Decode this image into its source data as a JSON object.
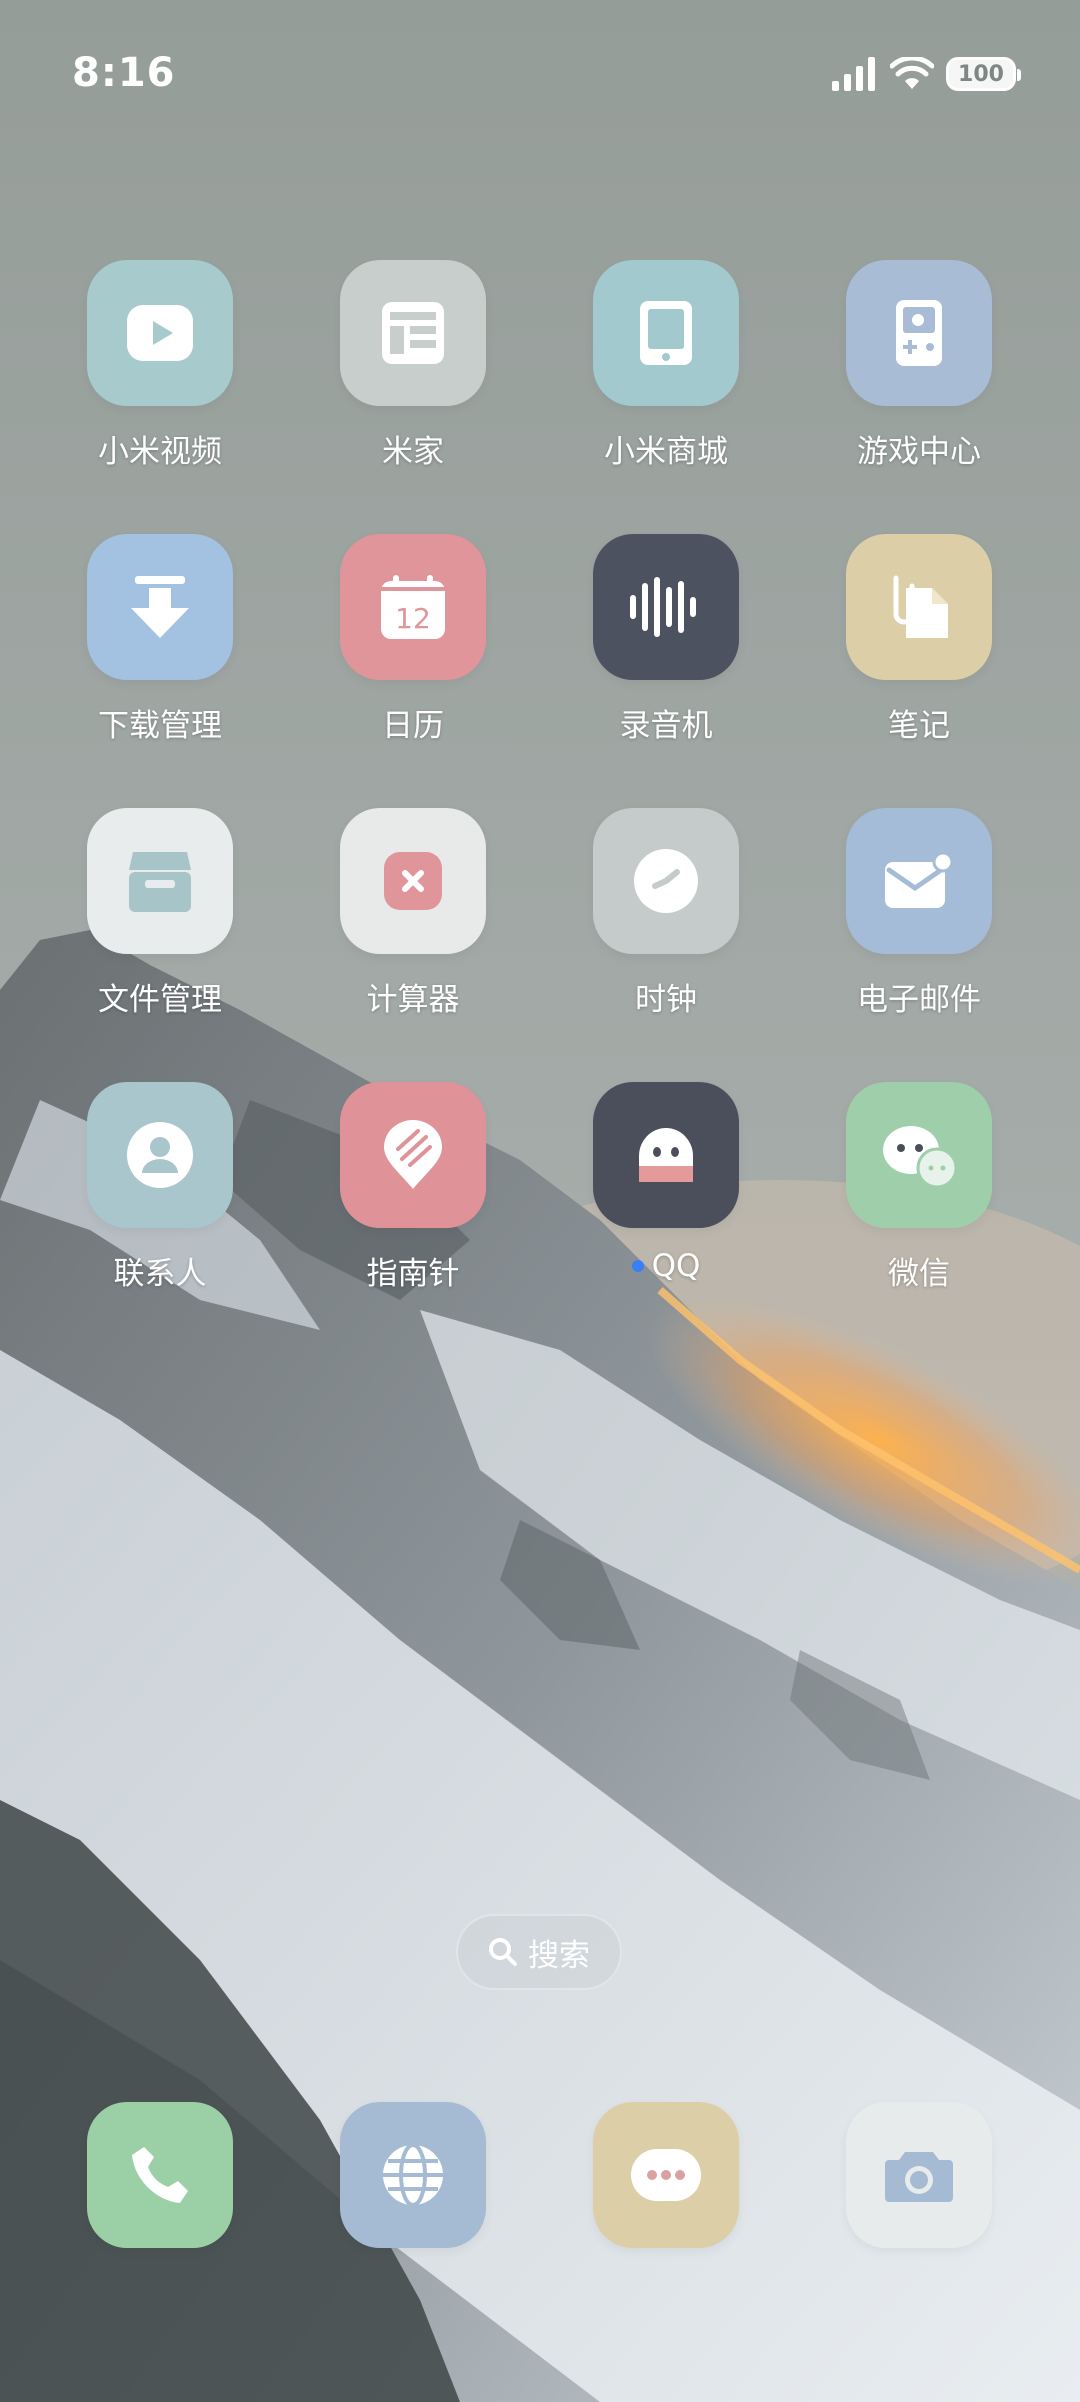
{
  "status_bar": {
    "time": "8:16",
    "battery_level": "100"
  },
  "apps": [
    {
      "label": "小米视频",
      "icon": "play-video-icon",
      "bg": "#a7cbcd"
    },
    {
      "label": "米家",
      "icon": "mijia-layout-icon",
      "bg": "#c7cecc"
    },
    {
      "label": "小米商城",
      "icon": "tablet-store-icon",
      "bg": "#a2c9cd"
    },
    {
      "label": "游戏中心",
      "icon": "gameboy-icon",
      "bg": "#a8bcd6"
    },
    {
      "label": "下载管理",
      "icon": "download-arrow-icon",
      "bg": "#a3c2e2"
    },
    {
      "label": "日历",
      "icon": "calendar-icon",
      "bg": "#df959a",
      "extra": "12"
    },
    {
      "label": "录音机",
      "icon": "sound-wave-icon",
      "bg": "#4d5261"
    },
    {
      "label": "笔记",
      "icon": "note-clip-icon",
      "bg": "#dccfa8"
    },
    {
      "label": "文件管理",
      "icon": "file-tray-icon",
      "bg": "#e9ecec"
    },
    {
      "label": "计算器",
      "icon": "calculator-icon",
      "bg": "#e8eaea"
    },
    {
      "label": "时钟",
      "icon": "clock-icon",
      "bg": "#c5cbca"
    },
    {
      "label": "电子邮件",
      "icon": "mail-icon",
      "bg": "#a4bcd7"
    },
    {
      "label": "联系人",
      "icon": "contact-person-icon",
      "bg": "#a8c6cc"
    },
    {
      "label": "指南针",
      "icon": "compass-pin-icon",
      "bg": "#df9398"
    },
    {
      "label": "QQ",
      "icon": "qq-penguin-icon",
      "bg": "#4b4f5c",
      "badge": true
    },
    {
      "label": "微信",
      "icon": "wechat-bubbles-icon",
      "bg": "#9fcfaa"
    }
  ],
  "search": {
    "label": "搜索"
  },
  "dock": [
    {
      "name": "phone",
      "icon": "phone-icon",
      "bg": "#9bcfa6"
    },
    {
      "name": "browser",
      "icon": "globe-icon",
      "bg": "#a5bbd3"
    },
    {
      "name": "messages",
      "icon": "message-bubble-icon",
      "bg": "#dccfa8"
    },
    {
      "name": "camera",
      "icon": "camera-icon",
      "bg": "#e8ebec"
    }
  ]
}
